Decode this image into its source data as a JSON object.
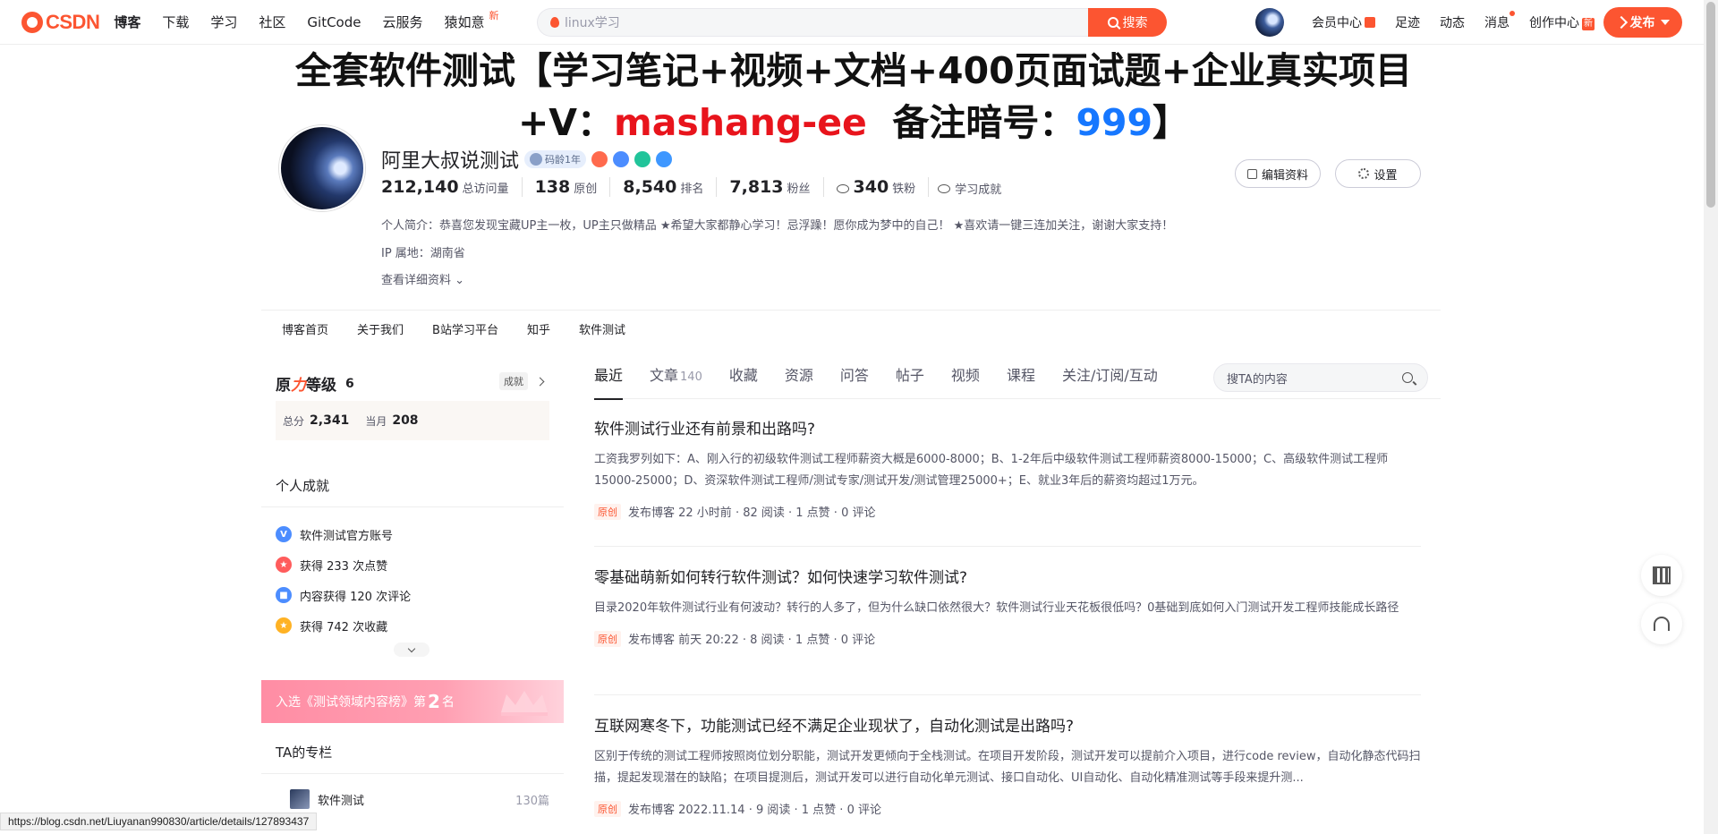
{
  "topbar": {
    "logo": "CSDN",
    "nav": [
      {
        "label": "博客",
        "active": true
      },
      {
        "label": "下载"
      },
      {
        "label": "学习"
      },
      {
        "label": "社区"
      },
      {
        "label": "GitCode"
      },
      {
        "label": "云服务"
      },
      {
        "label": "猿如意",
        "badge": "新"
      }
    ],
    "search_placeholder": "linux学习",
    "search_button": "搜索",
    "right_links": [
      "会员中心",
      "足迹",
      "动态",
      "消息",
      "创作中心"
    ],
    "publish_label": "发布"
  },
  "banner": {
    "line1": "全套软件测试【学习笔记+视频+文档+400页面试题+企业真实项目",
    "line2_prefix": "+V：",
    "line2_red": "mashang-ee",
    "line2_mid": "  备注暗号：",
    "line2_blue": "999",
    "line2_suffix": "】"
  },
  "profile": {
    "name": "阿里大叔说测试",
    "age_badge": "码龄1年",
    "stats": [
      {
        "num": "212,140",
        "label": "总访问量"
      },
      {
        "num": "138",
        "label": "原创"
      },
      {
        "num": "8,540",
        "label": "排名"
      },
      {
        "num": "7,813",
        "label": "粉丝"
      },
      {
        "num": "340",
        "label": "铁粉"
      }
    ],
    "achieve_link": "学习成就",
    "bio": "个人简介：恭喜您发现宝藏UP主一枚，UP主只做精品 ★希望大家都静心学习！忌浮躁！愿你成为梦中的自己！ ★喜欢请一键三连加关注，谢谢大家支持！",
    "ip": "IP 属地：湖南省",
    "more": "查看详细资料",
    "edit_btn": "编辑资料",
    "settings_btn": "设置"
  },
  "blog_nav": [
    "博客首页",
    "关于我们",
    "B站学习平台",
    "知乎",
    "软件测试"
  ],
  "sidebar": {
    "level_title_a": "原",
    "level_title_b": "力",
    "level_title_c": "等级",
    "level": "6",
    "level_link": "成就",
    "total_label": "总分",
    "total": "2,341",
    "month_label": "当月",
    "month": "208",
    "achieve_title": "个人成就",
    "achievements": [
      {
        "text": "软件测试官方账号",
        "color": "#4c8dff"
      },
      {
        "text": "获得 233 次点赞",
        "color": "#ff5c5c"
      },
      {
        "text": "内容获得 120 次评论",
        "color": "#4c8dff"
      },
      {
        "text": "获得 742 次收藏",
        "color": "#ffb224"
      }
    ],
    "rank_text_a": "入选《测试领域内容榜》第",
    "rank_num": "2",
    "rank_text_b": "名",
    "column_title": "TA的专栏",
    "column_item": "软件测试",
    "column_count": "130篇"
  },
  "main": {
    "tabs": [
      {
        "label": "最近",
        "active": true
      },
      {
        "label": "文章",
        "count": "140"
      },
      {
        "label": "收藏"
      },
      {
        "label": "资源"
      },
      {
        "label": "问答"
      },
      {
        "label": "帖子"
      },
      {
        "label": "视频"
      },
      {
        "label": "课程"
      },
      {
        "label": "关注/订阅/互动"
      }
    ],
    "search_placeholder": "搜TA的内容",
    "articles": [
      {
        "title": "软件测试行业还有前景和出路吗?",
        "desc": "工资我罗列如下：A、刚入行的初级软件测试工程师薪资大概是6000-8000；B、1-2年后中级软件测试工程师薪资8000-15000；C、高级软件测试工程师15000-25000；D、资深软件测试工程师/测试专家/测试开发/测试管理25000+；E、就业3年后的薪资均超过1万元。",
        "tag": "原创",
        "meta": "发布博客 22 小时前 · 82 阅读 · 1 点赞 · 0 评论"
      },
      {
        "title": "零基础萌新如何转行软件测试？如何快速学习软件测试?",
        "desc": "目录2020年软件测试行业有何波动？转行的人多了，但为什么缺口依然很大？软件测试行业天花板很低吗？0基础到底如何入门测试开发工程师技能成长路径",
        "tag": "原创",
        "meta": "发布博客 前天 20:22 · 8 阅读 · 1 点赞 · 0 评论"
      },
      {
        "title": "互联网寒冬下，功能测试已经不满足企业现状了，自动化测试是出路吗?",
        "desc": "区别于传统的测试工程师按照岗位划分职能，测试开发更倾向于全栈测试。在项目开发阶段，测试开发可以提前介入项目，进行code review，自动化静态代码扫描，提起发现潜在的缺陷；在项目提测后，测试开发可以进行自动化单元测试、接口自动化、UI自动化、自动化精准测试等手段来提升测...",
        "tag": "原创",
        "meta": "发布博客 2022.11.14 · 9 阅读 · 1 点赞 · 0 评论"
      }
    ]
  },
  "status_url": "https://blog.csdn.net/Liuyanan990830/article/details/127893437"
}
